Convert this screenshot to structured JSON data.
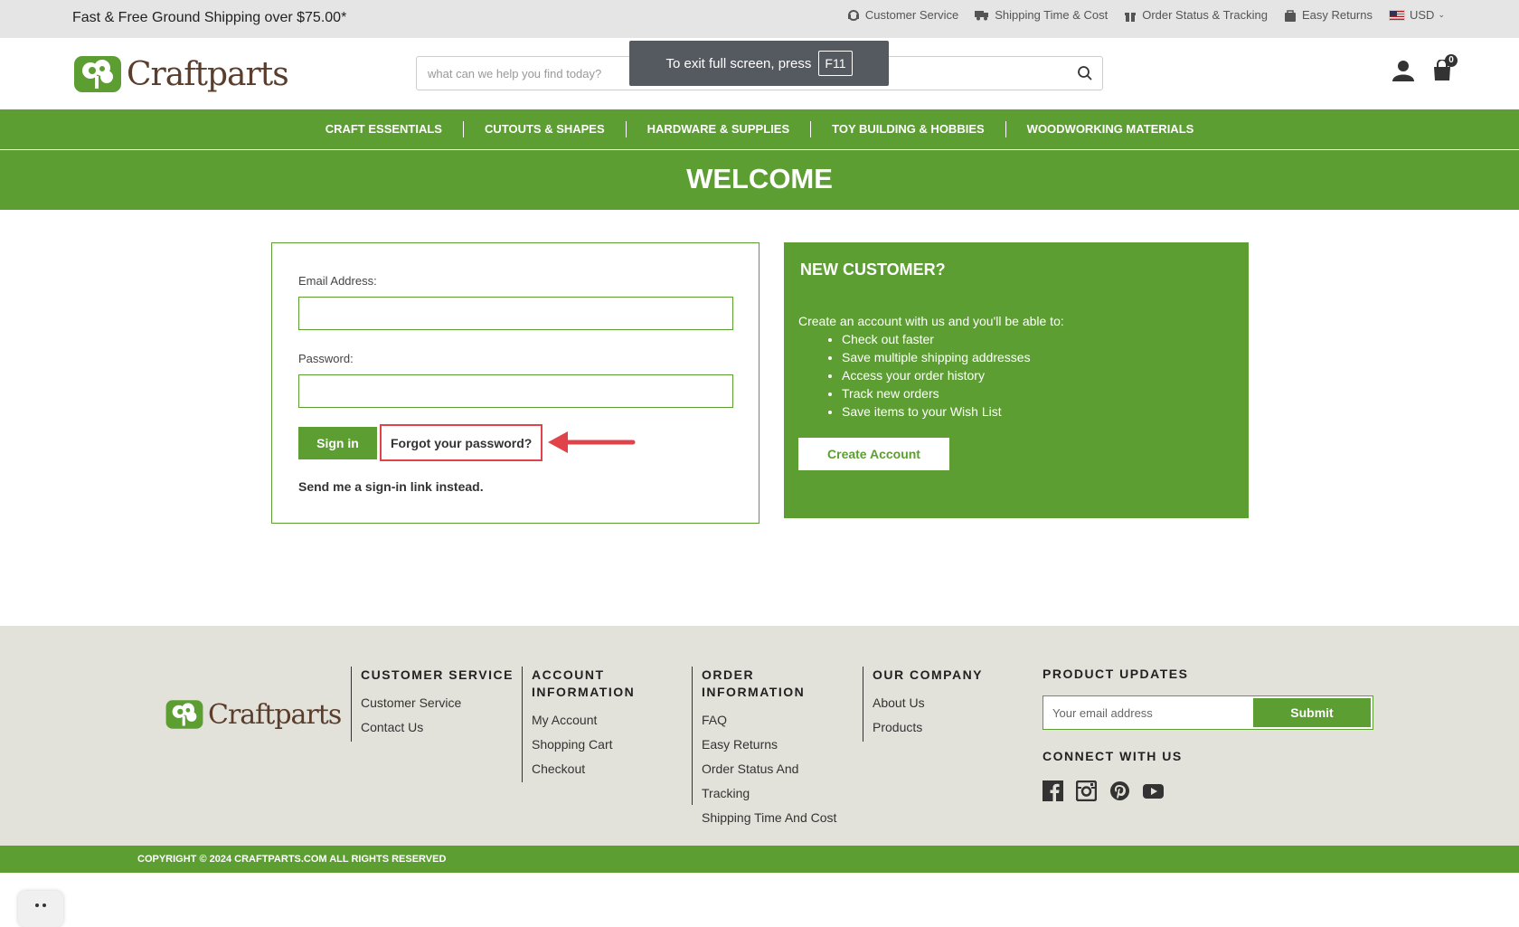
{
  "topbar": {
    "promo": "Fast & Free Ground Shipping over $75.00*",
    "links": [
      "Customer Service",
      "Shipping Time & Cost",
      "Order Status & Tracking",
      "Easy Returns"
    ],
    "currency": "USD"
  },
  "header": {
    "logo_text": "Craftparts",
    "search_placeholder": "what can we help you find today?",
    "cart_count": "0",
    "fullscreen_msg": "To exit full screen, press",
    "fullscreen_key": "F11"
  },
  "nav": [
    "CRAFT ESSENTIALS",
    "CUTOUTS & SHAPES",
    "HARDWARE & SUPPLIES",
    "TOY BUILDING & HOBBIES",
    "WOODWORKING MATERIALS"
  ],
  "page_title": "WELCOME",
  "login": {
    "email_label": "Email Address:",
    "email_value": "",
    "password_label": "Password:",
    "password_value": "",
    "signin_button": "Sign in",
    "forgot_link": "Forgot your password?",
    "signin_link": "Send me a sign-in link instead."
  },
  "new_customer": {
    "title": "NEW CUSTOMER?",
    "intro": "Create an account with us and you'll be able to:",
    "benefits": [
      "Check out faster",
      "Save multiple shipping addresses",
      "Access your order history",
      "Track new orders",
      "Save items to your Wish List"
    ],
    "button": "Create Account"
  },
  "footer": {
    "logo_text": "Craftparts",
    "columns": [
      {
        "title": "CUSTOMER SERVICE",
        "links": [
          "Customer Service",
          "Contact Us"
        ]
      },
      {
        "title": "ACCOUNT INFORMATION",
        "links": [
          "My Account",
          "Shopping Cart",
          "Checkout"
        ]
      },
      {
        "title": "ORDER INFORMATION",
        "links": [
          "FAQ",
          "Easy Returns",
          "Order Status And Tracking",
          "Shipping Time And Cost"
        ]
      },
      {
        "title": "OUR COMPANY",
        "links": [
          "About Us",
          "Products"
        ]
      }
    ],
    "updates_title": "PRODUCT UPDATES",
    "email_placeholder": "Your email address",
    "submit": "Submit",
    "connect_title": "CONNECT WITH US",
    "social": [
      "facebook-icon",
      "instagram-icon",
      "pinterest-icon",
      "youtube-icon"
    ],
    "copyright": "COPYRIGHT © 2024 CRAFTPARTS.COM ALL RIGHTS RESERVED"
  },
  "colors": {
    "brand_green": "#5c9e31",
    "highlight_red": "#e0444a",
    "footer_bg": "#e3e2da"
  }
}
